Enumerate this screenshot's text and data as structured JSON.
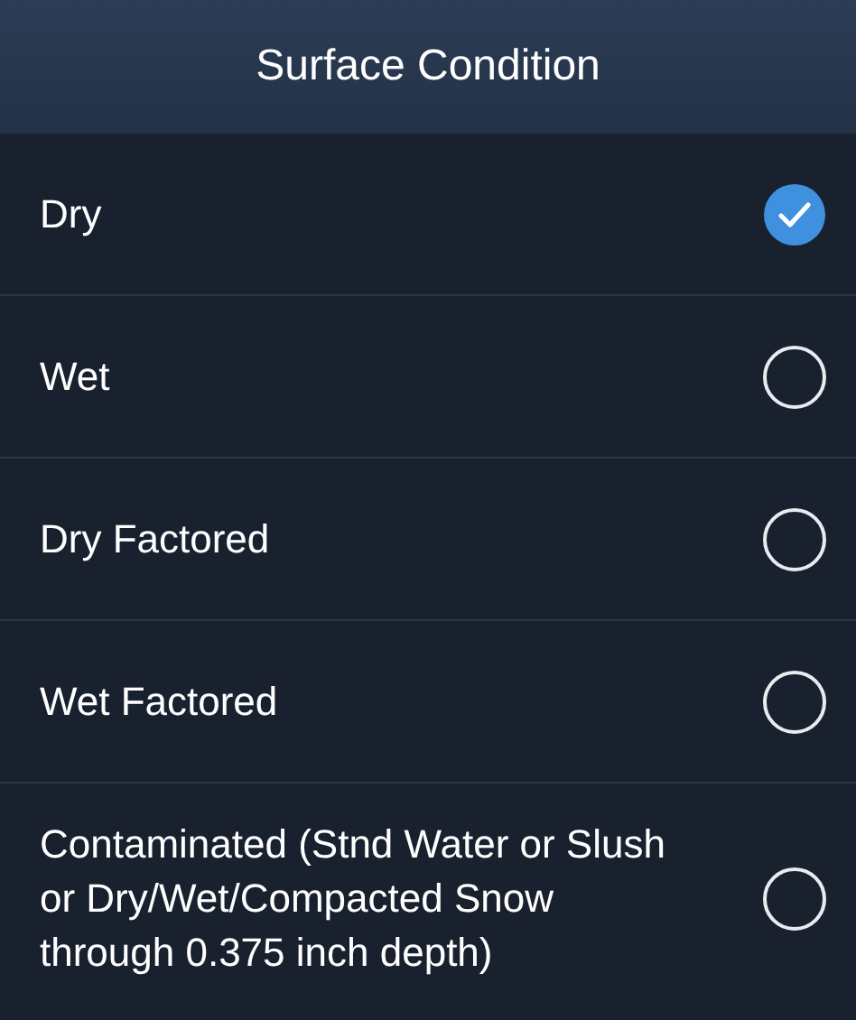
{
  "header": {
    "title": "Surface Condition"
  },
  "options": [
    {
      "label": "Dry",
      "selected": true
    },
    {
      "label": "Wet",
      "selected": false
    },
    {
      "label": "Dry Factored",
      "selected": false
    },
    {
      "label": "Wet Factored",
      "selected": false
    },
    {
      "label": "Contaminated (Stnd Water or Slush or Dry/Wet/Compacted Snow through 0.375 inch depth)",
      "selected": false
    }
  ]
}
